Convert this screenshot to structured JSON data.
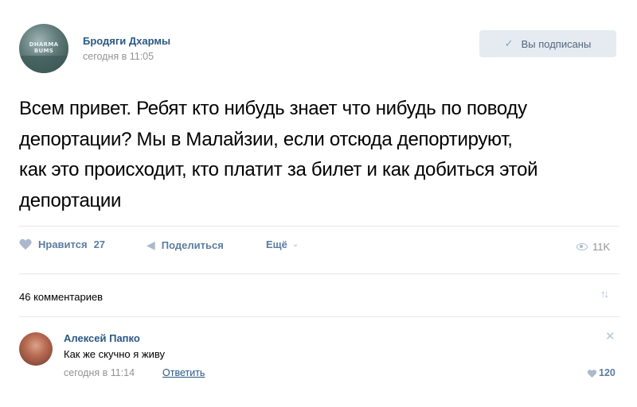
{
  "group": {
    "name": "Бродяги Дхармы",
    "time": "сегодня в 11:05",
    "avatar_text": "DHARMA BUMS"
  },
  "subscribe": {
    "label": "Вы подписаны",
    "icon": "check-icon"
  },
  "post": {
    "lines": [
      "Всем привет. Ребят кто нибудь знает что нибудь по поводу",
      "депортации? Мы в Малайзии, если отсюда депортируют,",
      "как это происходит, кто платит за билет и как добиться этой",
      "депортации"
    ]
  },
  "actions": {
    "like_label": "Нравится",
    "like_count": "27",
    "share_label": "Поделиться",
    "more_label": "Ещё",
    "views": "11K"
  },
  "comments": {
    "count_label": "46 комментариев",
    "items": [
      {
        "author": "Алексей Папко",
        "text": "Как же скучно я живу",
        "time": "сегодня в 11:14",
        "reply_label": "Ответить",
        "likes": "120"
      }
    ]
  },
  "colors": {
    "link": "#2a5885",
    "muted": "#939393",
    "button_bg": "#e5ebf1"
  }
}
